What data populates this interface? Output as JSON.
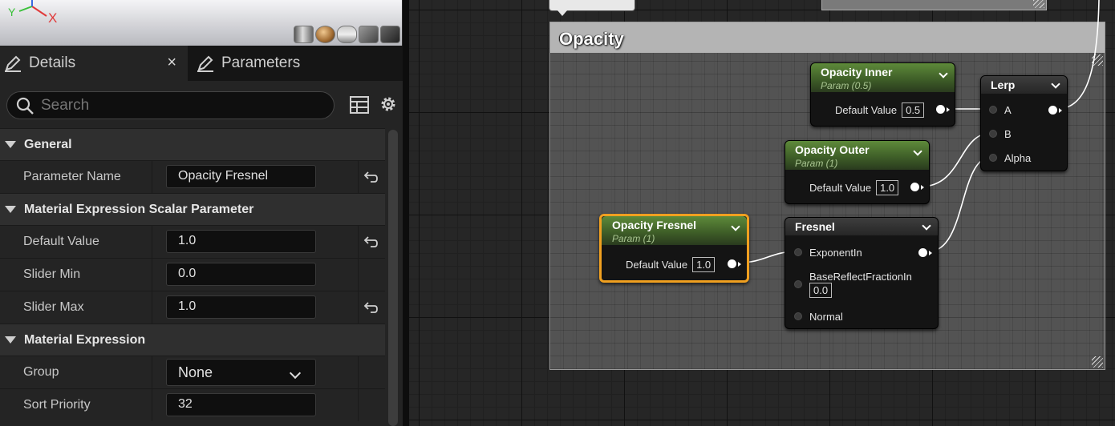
{
  "viewport": {
    "axes": {
      "x": "X",
      "y": "Y"
    },
    "preview_shapes": [
      "cylinder-icon",
      "sphere-icon",
      "plane-icon",
      "cube-icon",
      "custom-mesh-icon"
    ]
  },
  "tabs": {
    "details_label": "Details",
    "parameters_label": "Parameters",
    "close_glyph": "×"
  },
  "search": {
    "placeholder": "Search"
  },
  "details": {
    "categories": {
      "general": "General",
      "scalar": "Material Expression Scalar Parameter",
      "expression": "Material Expression"
    },
    "rows": {
      "parameter_name": {
        "label": "Parameter Name",
        "value": "Opacity Fresnel"
      },
      "default_value": {
        "label": "Default Value",
        "value": "1.0"
      },
      "slider_min": {
        "label": "Slider Min",
        "value": "0.0"
      },
      "slider_max": {
        "label": "Slider Max",
        "value": "1.0"
      },
      "group": {
        "label": "Group",
        "value": "None"
      },
      "sort_priority": {
        "label": "Sort Priority",
        "value": "32"
      }
    }
  },
  "graph": {
    "comment_title": "Opacity",
    "nodes": {
      "opacity_inner": {
        "title": "Opacity Inner",
        "subtitle": "Param (0.5)",
        "pin_label": "Default Value",
        "value": "0.5"
      },
      "opacity_outer": {
        "title": "Opacity Outer",
        "subtitle": "Param (1)",
        "pin_label": "Default Value",
        "value": "1.0"
      },
      "opacity_fresnel": {
        "title": "Opacity Fresnel",
        "subtitle": "Param (1)",
        "pin_label": "Default Value",
        "value": "1.0"
      },
      "fresnel": {
        "title": "Fresnel",
        "pins": {
          "exponent": "ExponentIn",
          "base_reflect": "BaseReflectFractionIn",
          "base_reflect_value": "0.0",
          "normal": "Normal"
        }
      },
      "lerp": {
        "title": "Lerp",
        "pins": {
          "a": "A",
          "b": "B",
          "alpha": "Alpha"
        }
      }
    }
  },
  "colors": {
    "selection": "#f0a020",
    "param_header": "#5e8a3a",
    "wire": "#ffffff"
  }
}
